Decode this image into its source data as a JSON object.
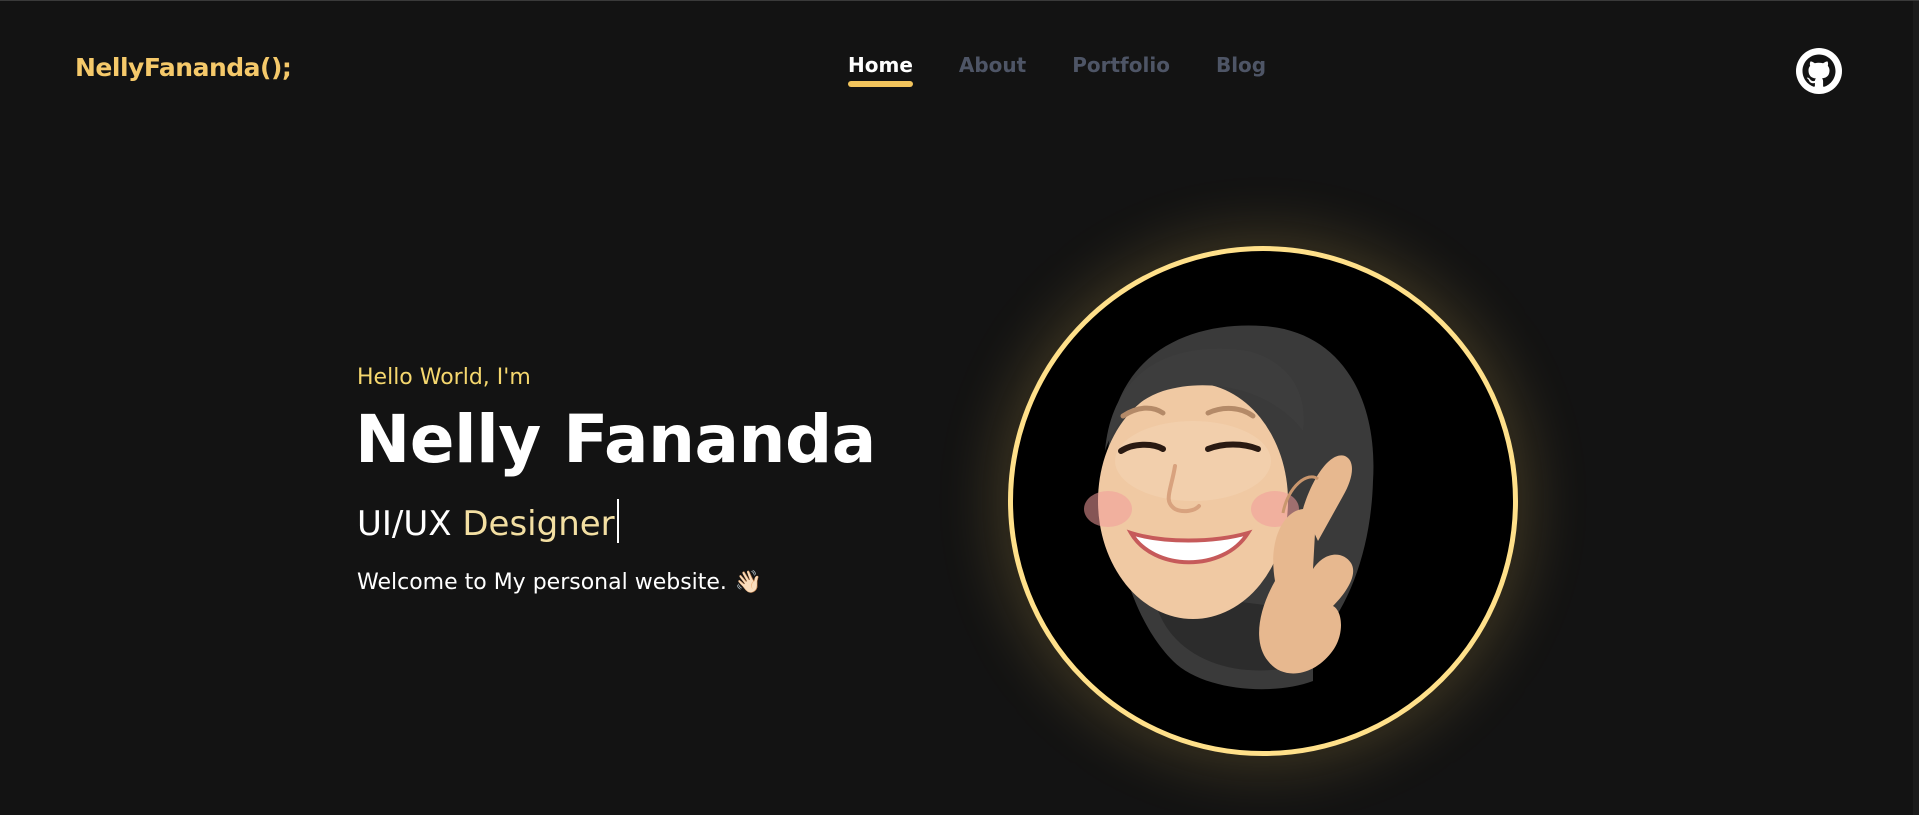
{
  "brand": {
    "logo_text": "NellyFananda();",
    "accent_color": "#f5c96a"
  },
  "nav": {
    "items": [
      {
        "label": "Home",
        "active": true
      },
      {
        "label": "About",
        "active": false
      },
      {
        "label": "Portfolio",
        "active": false
      },
      {
        "label": "Blog",
        "active": false
      }
    ]
  },
  "header": {
    "github_icon": "github-icon"
  },
  "hero": {
    "greeting": "Hello World, I'm",
    "name": "Nelly Fananda",
    "role_prefix": "UI/UX ",
    "role_accent": "Designer",
    "welcome": "Welcome to My personal website.",
    "welcome_emoji": "👋🏻"
  },
  "avatar": {
    "icon": "memoji-avatar",
    "ring_color": "#ffe08a",
    "background": "#000000"
  }
}
